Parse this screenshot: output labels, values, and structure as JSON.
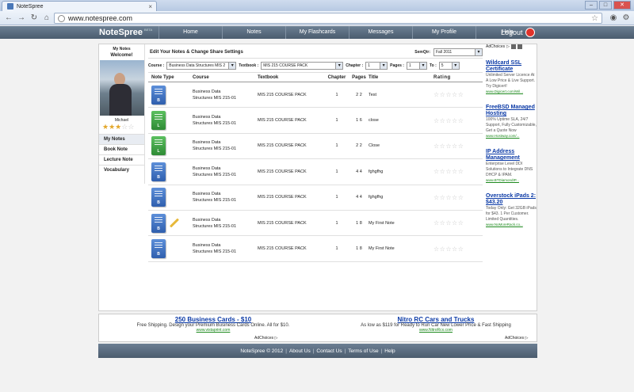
{
  "browser": {
    "tab_title": "NoteSpree",
    "tab_close": "×",
    "url": "www.notespree.com",
    "window_controls": [
      "–",
      "□",
      "✕"
    ]
  },
  "site": {
    "logo": "NoteSpree",
    "logo_badge": "BETA",
    "nav": [
      "Home",
      "Notes",
      "My Flashcards",
      "Messages",
      "My Profile",
      "Help"
    ],
    "logout": "Logout"
  },
  "sidebar": {
    "title": "My Notes",
    "welcome": "Welcome!",
    "name": "Michael",
    "rating": 3,
    "rating_max": 5,
    "menu": [
      "My Notes",
      "Book Note",
      "Lecture Note",
      "Vocabulary"
    ]
  },
  "main": {
    "heading": "Edit Your Notes & Change Share Settings",
    "semqtr_label": "SemQtr:",
    "semqtr_value": "Fall 2011",
    "filters": {
      "course_label": "Course :",
      "course_value": "Business Data Structures MIS 2",
      "textbook_label": "Textbook :",
      "textbook_value": "MIS 215 COURSE PACK",
      "chapter_label": "Chapter :",
      "chapter_value": "1",
      "pages_label": "Pages :",
      "pages_value": "1",
      "to_label": "To :",
      "to_value": "5"
    },
    "columns": [
      "Note Type",
      "Course",
      "Textbook",
      "Chapter",
      "Pages",
      "Title",
      "Rating"
    ],
    "rows": [
      {
        "type": "B",
        "course_line1": "Business Data",
        "course_line2": "Structures MIS 215-01",
        "textbook": "MIS 215 COURSE PACK",
        "chapter": "1",
        "pages": "2 2",
        "title": "Test"
      },
      {
        "type": "L",
        "course_line1": "Business Data",
        "course_line2": "Structures MIS 215-01",
        "textbook": "MIS 215 COURSE PACK",
        "chapter": "1",
        "pages": "1 6",
        "title": "close"
      },
      {
        "type": "L",
        "course_line1": "Business Data",
        "course_line2": "Structures MIS 215-01",
        "textbook": "MIS 215 COURSE PACK",
        "chapter": "1",
        "pages": "2 2",
        "title": "Close"
      },
      {
        "type": "B",
        "course_line1": "Business Data",
        "course_line2": "Structures MIS 215-01",
        "textbook": "MIS 215 COURSE PACK",
        "chapter": "1",
        "pages": "4 4",
        "title": "fghgfhg"
      },
      {
        "type": "B",
        "course_line1": "Business Data",
        "course_line2": "Structures MIS 215-01",
        "textbook": "MIS 215 COURSE PACK",
        "chapter": "1",
        "pages": "4 4",
        "title": "fghgfhg"
      },
      {
        "type": "B",
        "course_line1": "Business Data",
        "course_line2": "Structures MIS 215-01",
        "textbook": "MIS 215 COURSE PACK",
        "chapter": "1",
        "pages": "1 8",
        "title": "My First Note",
        "editable": true
      },
      {
        "type": "B",
        "course_line1": "Business Data",
        "course_line2": "Structures MIS 215-01",
        "textbook": "MIS 215 COURSE PACK",
        "chapter": "1",
        "pages": "1 8",
        "title": "My First Note"
      }
    ],
    "row_rating": "☆☆☆☆☆"
  },
  "right_ads": {
    "adchoices": "AdChoices",
    "ads": [
      {
        "headline": "Wildcard SSL Certificate",
        "desc": "Unlimited Server Licence At A Low Price & Live Support. Try Digicert!",
        "url": "www.Digicert.com/Wil..."
      },
      {
        "headline": "FreeBSD Managed Hosting",
        "desc": "100% Uptime SLA, 24/7 Support, Fully Customizable, Get a Quote Now",
        "url": "www.Hostway.com/..."
      },
      {
        "headline": "IP Address Management",
        "desc": "Enterprise Level DDI Solutions to Integrate DNS DHCP & IPAM.",
        "url": "www.BTDiamondIP..."
      },
      {
        "headline": "Overstock iPads 2: $43.20",
        "desc": "Today Only: Get 32GB iPads for $43. 1 Per Customer. Limited Quantities.",
        "url": "www.NoMoreRack.co..."
      }
    ]
  },
  "bottom_ads": {
    "ad1": {
      "headline": "250 Business Cards - $10",
      "desc": "Free Shipping. Design your Premium Business Cards Online. All for $10.",
      "url": "www.vistaprint.com"
    },
    "ad2": {
      "headline": "Nitro RC Cars and Trucks",
      "desc": "As low as $119 for Ready to Run Car New Lower Price & Fast Shipping",
      "url": "www.NitroRcx.com"
    },
    "adchoices": "AdChoices"
  },
  "footer": {
    "copyright": "NoteSpree © 2012",
    "links": [
      "About Us",
      "Contact Us",
      "Terms of Use",
      "Help"
    ],
    "sep": "|"
  }
}
